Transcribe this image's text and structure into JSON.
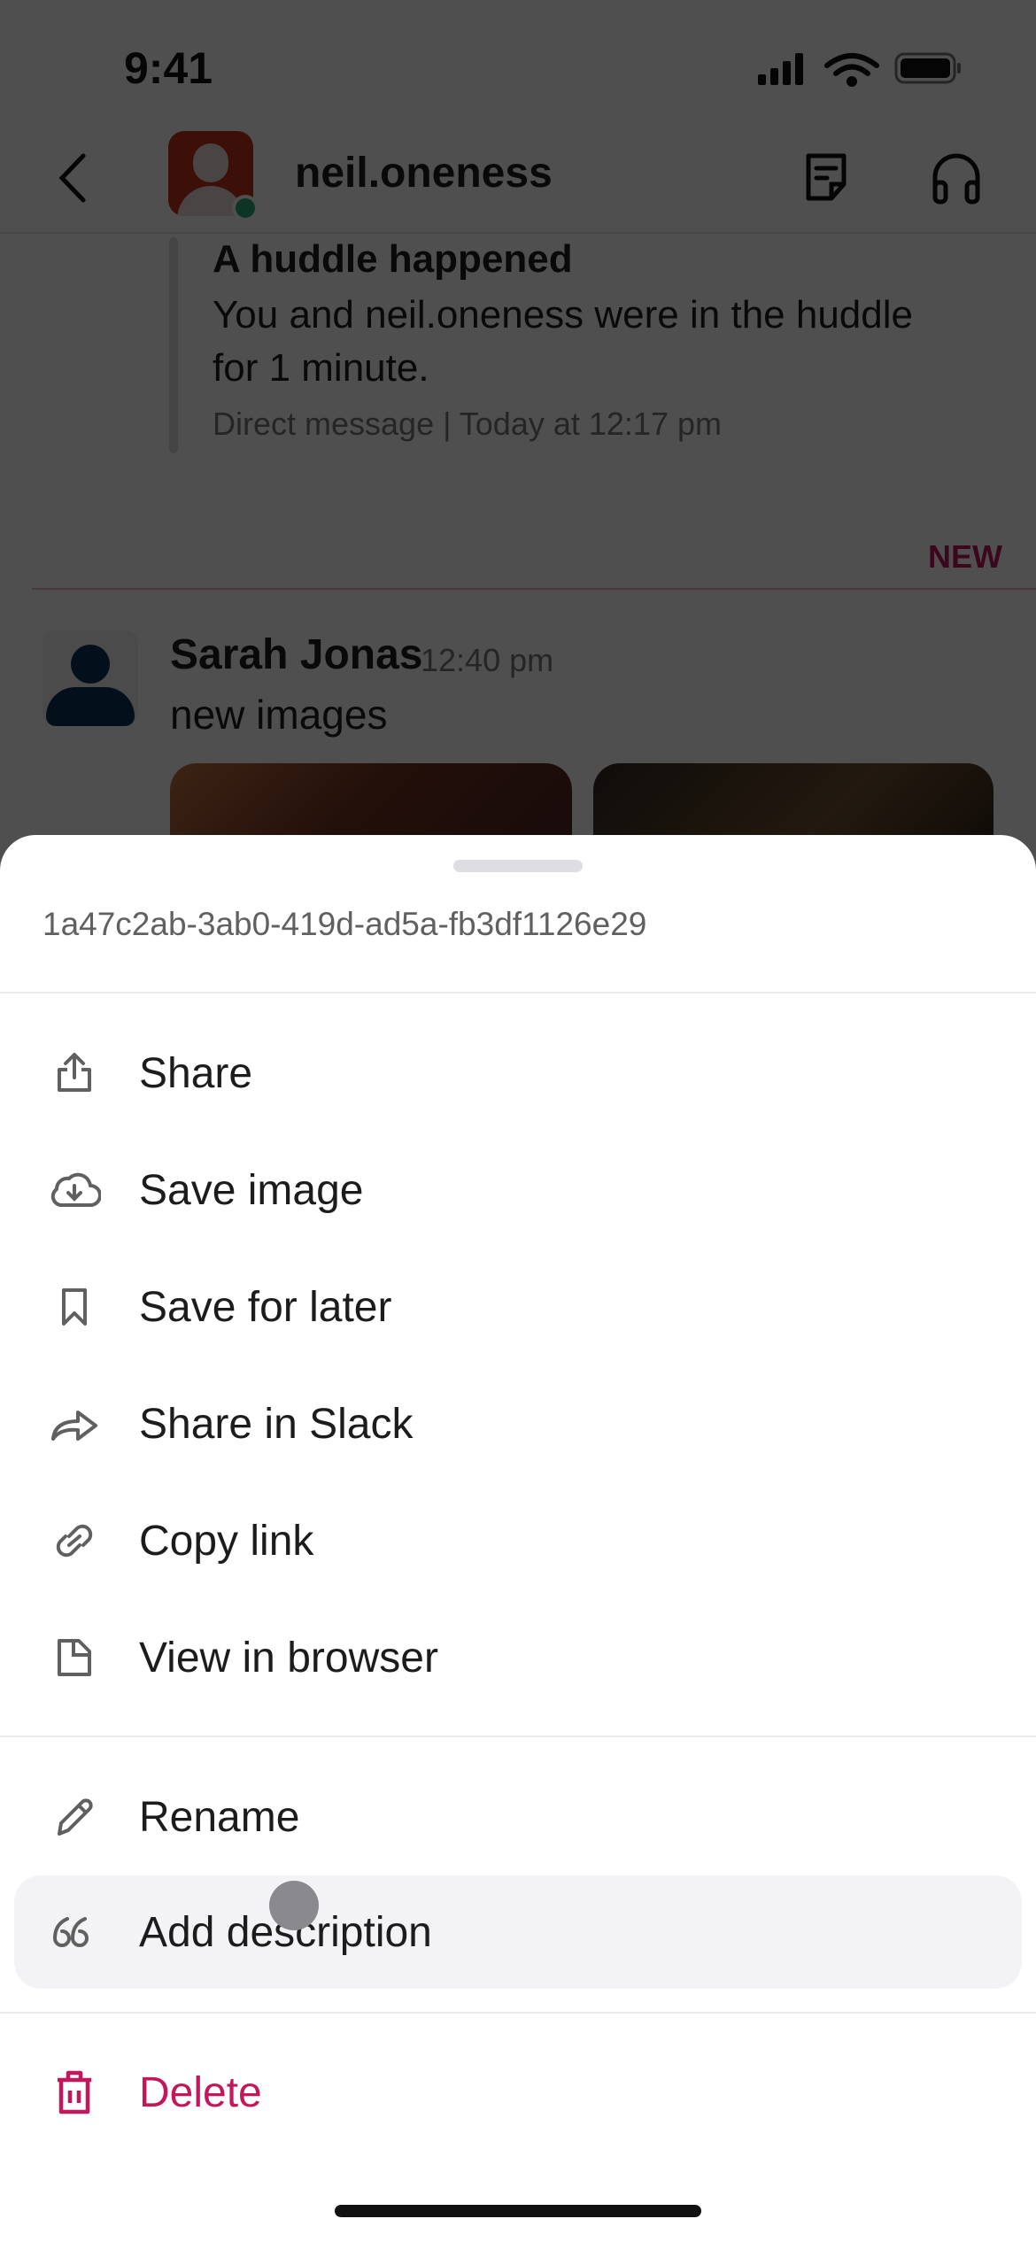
{
  "status_bar": {
    "time": "9:41"
  },
  "header": {
    "title": "neil.oneness",
    "presence": "online",
    "icons": [
      "back-chevron-icon",
      "canvas-icon",
      "headphones-icon"
    ]
  },
  "conversation": {
    "huddle": {
      "title": "A huddle happened",
      "text": "You and neil.oneness were in the huddle for 1 minute.",
      "meta": "Direct message | Today at 12:17 pm"
    },
    "new_label": "NEW",
    "message": {
      "sender": "Sarah Jonas",
      "time": "12:40 pm",
      "text": "new images"
    }
  },
  "sheet": {
    "file_id": "1a47c2ab-3ab0-419d-ad5a-fb3df1126e29",
    "groups": [
      [
        {
          "label": "Share",
          "icon": "share-icon"
        },
        {
          "label": "Save image",
          "icon": "cloud-download-icon"
        },
        {
          "label": "Save for later",
          "icon": "bookmark-icon"
        },
        {
          "label": "Share in Slack",
          "icon": "forward-arrow-icon"
        },
        {
          "label": "Copy link",
          "icon": "link-icon"
        },
        {
          "label": "View in browser",
          "icon": "file-icon"
        }
      ],
      [
        {
          "label": "Rename",
          "icon": "pencil-icon"
        },
        {
          "label": "Add description",
          "icon": "quote-icon",
          "highlighted": true
        }
      ],
      [
        {
          "label": "Delete",
          "icon": "trash-icon",
          "destructive": true
        }
      ]
    ]
  },
  "colors": {
    "destructive": "#c4175b",
    "presence": "#2bac76",
    "highlight": "#f3f2f5"
  }
}
